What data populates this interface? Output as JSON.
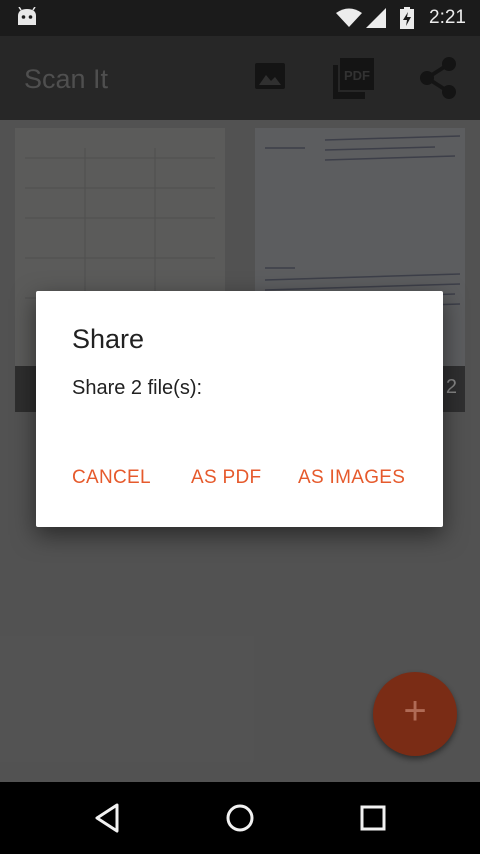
{
  "status_bar": {
    "time": "2:21"
  },
  "app_bar": {
    "title": "Scan It",
    "icons": [
      "image-icon",
      "pdf-icon",
      "share-icon"
    ],
    "pdf_icon_text": "PDF"
  },
  "thumbnails": [
    {
      "caption": ""
    },
    {
      "caption": "2"
    }
  ],
  "dialog": {
    "title": "Share",
    "message": "Share 2 file(s):",
    "buttons": {
      "cancel": "CANCEL",
      "as_pdf": "AS PDF",
      "as_images": "AS IMAGES"
    }
  },
  "fab": {
    "label": "+"
  },
  "colors": {
    "accent": "#e65a2c",
    "fab": "#7a2c15",
    "app_bar": "#3d3d3d",
    "status_bar": "#1b1b1b"
  }
}
